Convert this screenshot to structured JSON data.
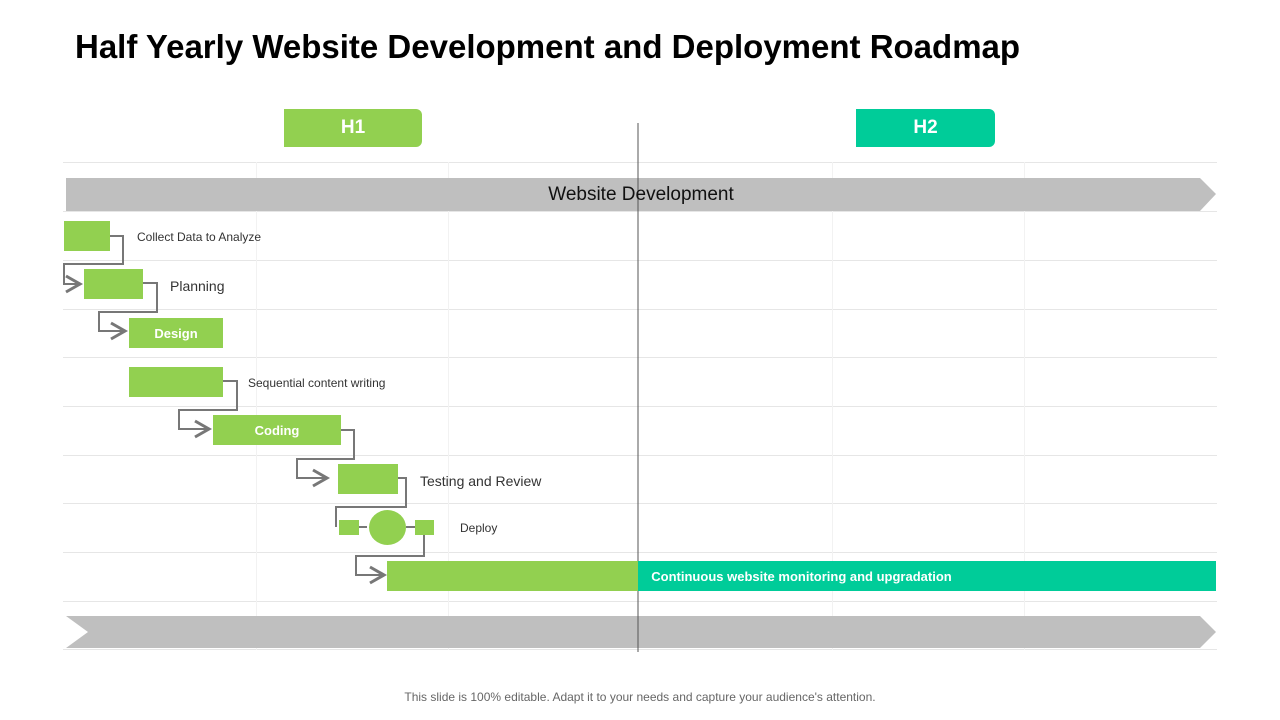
{
  "title": "Half Yearly Website Development and Deployment Roadmap",
  "periods": [
    {
      "label": "H1",
      "color": "#92d050"
    },
    {
      "label": "H2",
      "color": "#00cc99"
    }
  ],
  "phase_banner": "Website Development",
  "tasks": [
    {
      "label": "Collect Data to Analyze"
    },
    {
      "label": "Planning"
    },
    {
      "label": "Design"
    },
    {
      "label": "Sequential content writing"
    },
    {
      "label": "Coding"
    },
    {
      "label": "Testing and Review"
    },
    {
      "label": "Deploy"
    },
    {
      "label": "Continuous website monitoring and upgradation"
    }
  ],
  "footer": "This slide is 100% editable. Adapt it to your needs and capture your audience's attention."
}
